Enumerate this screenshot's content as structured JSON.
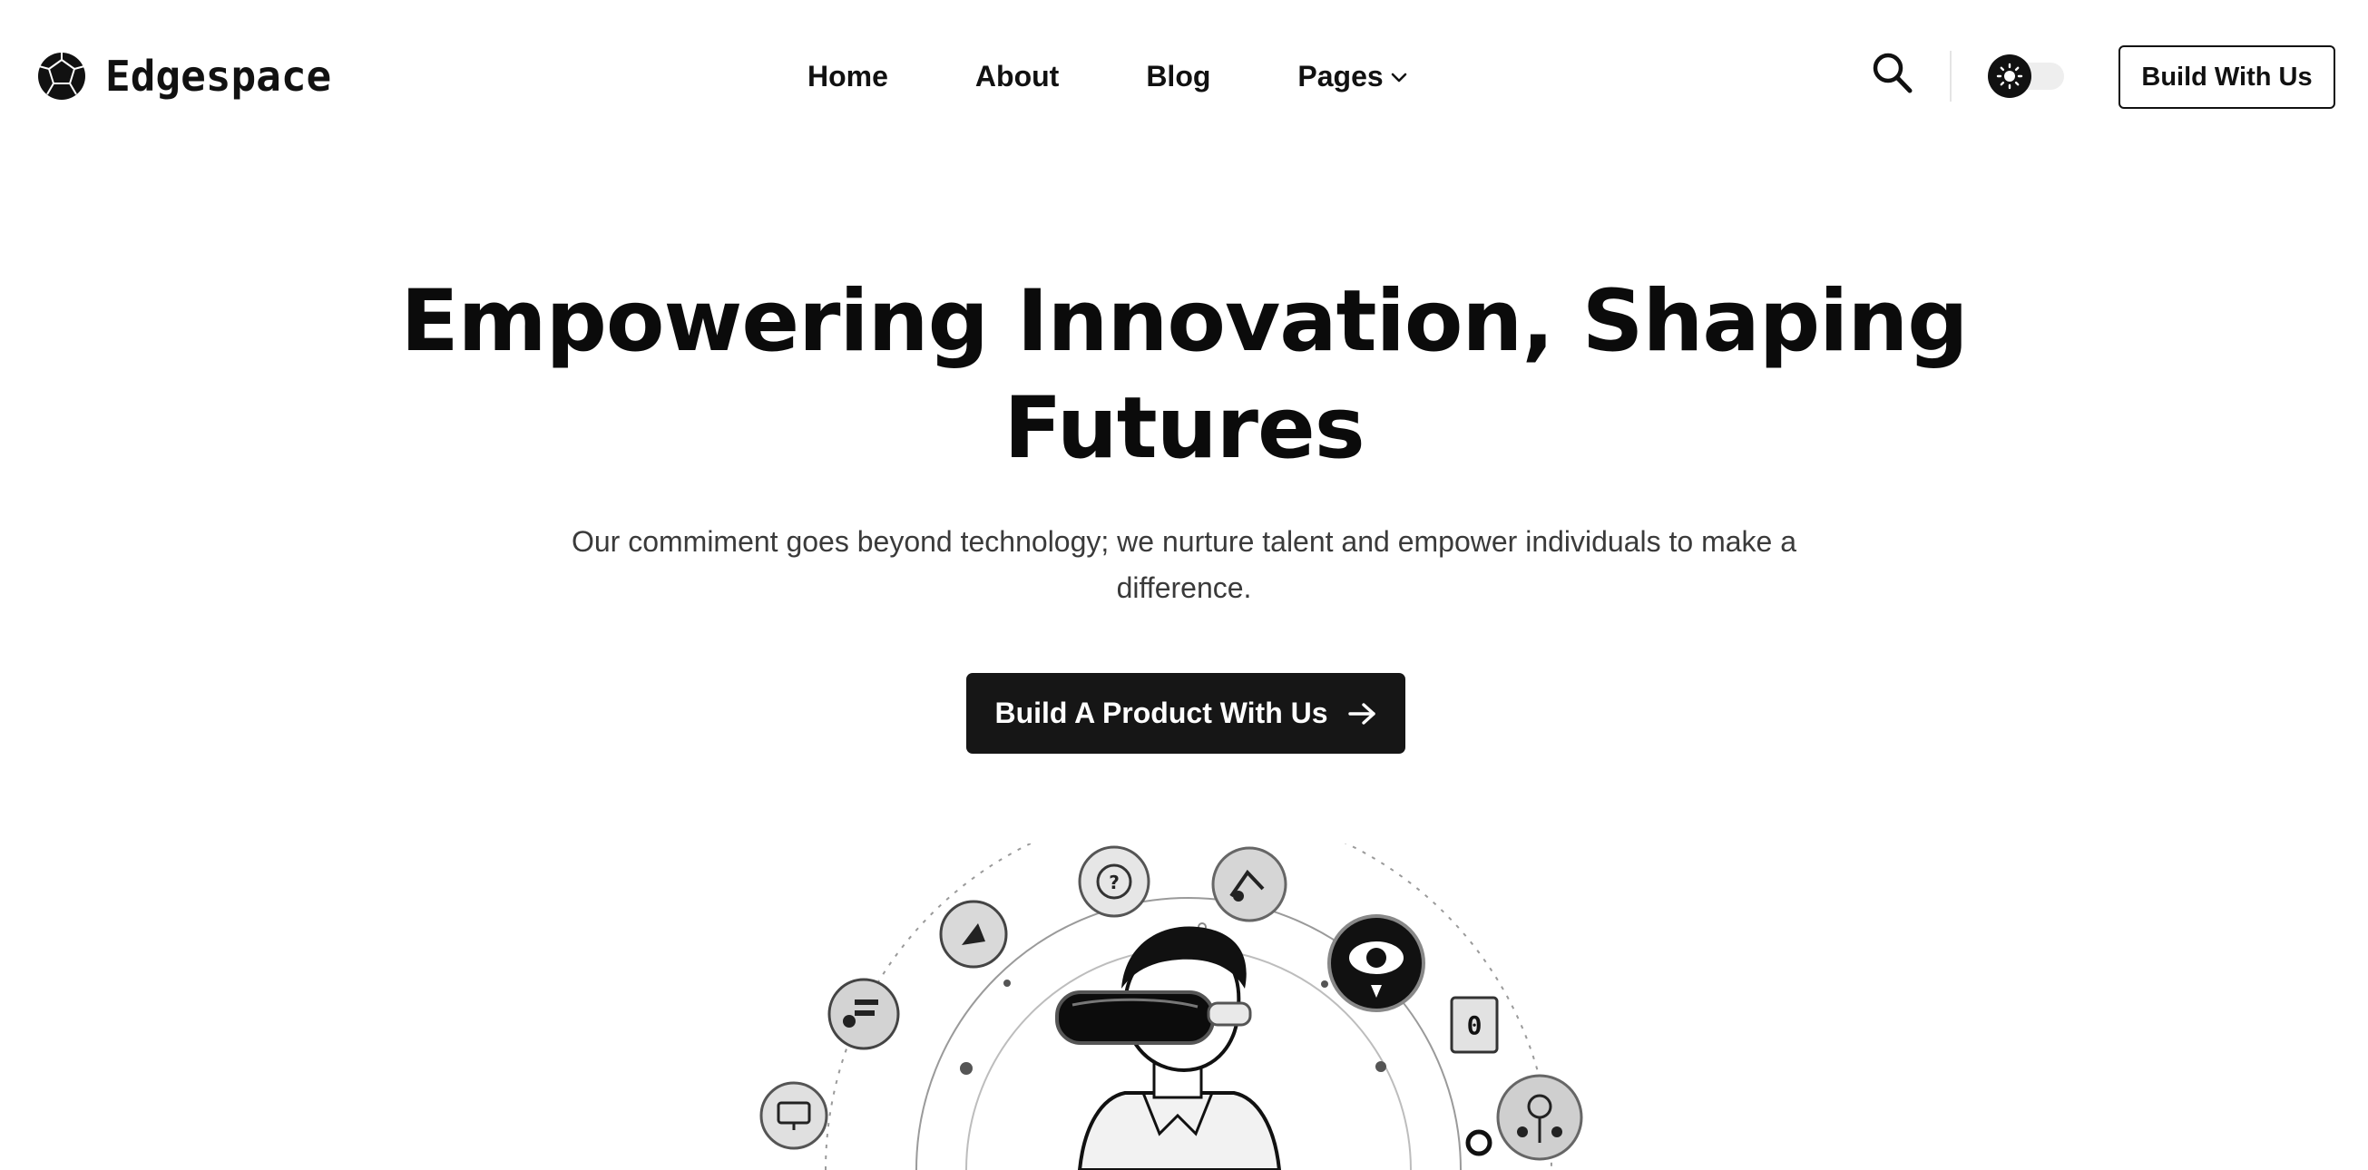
{
  "brand": {
    "name": "Edgespace",
    "logo_icon": "geodesic-ball-icon"
  },
  "nav": {
    "items": [
      {
        "label": "Home"
      },
      {
        "label": "About"
      },
      {
        "label": "Blog"
      },
      {
        "label": "Pages",
        "has_dropdown": true,
        "dropdown_icon": "chevron-down-icon"
      }
    ]
  },
  "header_actions": {
    "search_icon": "search-icon",
    "theme_toggle_icon": "sun-icon",
    "theme_toggle_state": "light",
    "cta_label": "Build With Us"
  },
  "hero": {
    "title_line1": "Empowering Innovation, Shaping",
    "title_line2": "Futures",
    "subtitle_line1": "Our commiment goes beyond technology; we nurture talent and empower individuals to make a",
    "subtitle_line2": "difference.",
    "cta_label": "Build A Product With Us",
    "cta_icon": "arrow-right-icon"
  },
  "illustration": {
    "subject": "person-wearing-vr-headset-illustration",
    "icons": [
      "chat-bubble-icon",
      "rocket-icon",
      "monitor-icon",
      "eye-icon",
      "code-icon",
      "network-icon",
      "graph-icon",
      "document-icon"
    ]
  },
  "colors": {
    "background": "#ffffff",
    "text": "#111111",
    "subtitle": "#3a3a3a",
    "primary_button": "#161616",
    "toggle_track": "#eeeeee"
  }
}
